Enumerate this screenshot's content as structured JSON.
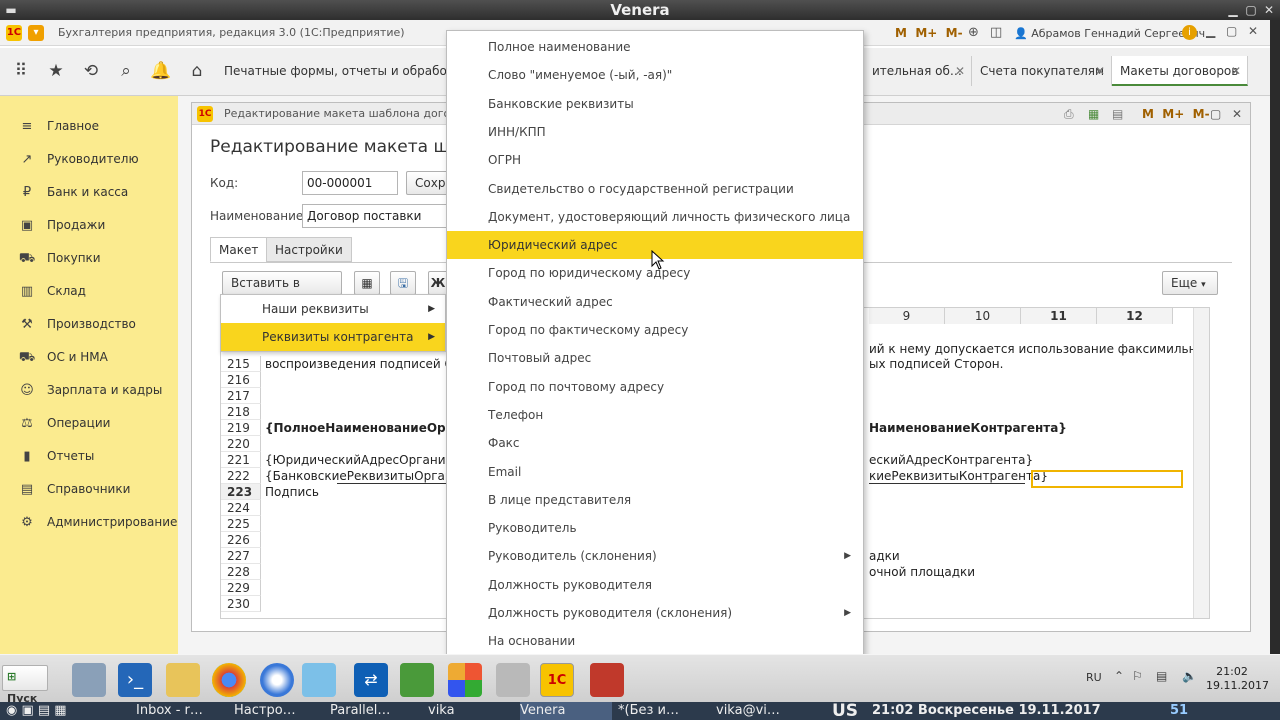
{
  "vnc": {
    "title": "Venera"
  },
  "app": {
    "title": "Бухгалтерия предприятия, редакция 3.0 (1С:Предприятие)",
    "user": "Абрамов Геннадий Сергеевич",
    "mplus_labels": [
      "M",
      "M+",
      "M-"
    ]
  },
  "nav": {
    "tabs": [
      {
        "label": "Печатные формы, отчеты и обработки"
      },
      {
        "label": "ительная об…"
      },
      {
        "label": "Счета покупателям"
      },
      {
        "label": "Макеты договоров"
      }
    ]
  },
  "sidebar": {
    "items": [
      {
        "label": "Главное",
        "icon": "menu-icon"
      },
      {
        "label": "Руководителю",
        "icon": "trend-icon"
      },
      {
        "label": "Банк и касса",
        "icon": "coin-icon"
      },
      {
        "label": "Продажи",
        "icon": "bag-icon"
      },
      {
        "label": "Покупки",
        "icon": "cart-icon"
      },
      {
        "label": "Склад",
        "icon": "warehouse-icon"
      },
      {
        "label": "Производство",
        "icon": "factory-icon"
      },
      {
        "label": "ОС и НМА",
        "icon": "truck-icon"
      },
      {
        "label": "Зарплата и кадры",
        "icon": "person-icon"
      },
      {
        "label": "Операции",
        "icon": "operations-icon"
      },
      {
        "label": "Отчеты",
        "icon": "reports-icon"
      },
      {
        "label": "Справочники",
        "icon": "book-icon"
      },
      {
        "label": "Администрирование",
        "icon": "gear-icon"
      }
    ]
  },
  "document": {
    "window_title": "Редактирование макета шаблона договора *",
    "heading": "Редактирование макета шабл",
    "code_label": "Код:",
    "code_value": "00-000001",
    "save_button": "Сохр",
    "name_label": "Наименование:",
    "name_value": "Договор поставки",
    "tabs": [
      "Макет",
      "Настройки"
    ],
    "insert_button": "Вставить в текст",
    "bold_button": "Ж",
    "more_button": "Еще",
    "submenu": [
      "Наши реквизиты",
      "Реквизиты контрагента"
    ],
    "col_headers": [
      "9",
      "10",
      "11",
      "12"
    ],
    "rows": [
      {
        "num": "215",
        "left": "воспроизведения подписей Сто",
        "right": "ых подписей Сторон."
      },
      {
        "num": "216",
        "left": "",
        "right": ""
      },
      {
        "num": "217",
        "left": "",
        "right": ""
      },
      {
        "num": "218",
        "left": "",
        "right": ""
      },
      {
        "num": "219",
        "left": "{ПолноеНаименованиеОрган",
        "right": "НаименованиеКонтрагента}"
      },
      {
        "num": "220",
        "left": "",
        "right": ""
      },
      {
        "num": "221",
        "left": "{ЮридическийАдресОрганизац",
        "right": "ескийАдресКонтрагента}"
      },
      {
        "num": "222",
        "left": "{БанковскиеРеквизитыОрганиза",
        "right": "киеРеквизитыКонтрагента}"
      },
      {
        "num": "223",
        "left": "Подпись",
        "right": ""
      },
      {
        "num": "224",
        "left": "",
        "right": ""
      },
      {
        "num": "225",
        "left": "",
        "right": ""
      },
      {
        "num": "226",
        "left": "",
        "right": ""
      },
      {
        "num": "227",
        "left": "",
        "right": "адки"
      },
      {
        "num": "228",
        "left": "",
        "right": "очной площадки"
      },
      {
        "num": "229",
        "left": "",
        "right": ""
      },
      {
        "num": "230",
        "left": "",
        "right": ""
      }
    ],
    "row214_right": "ий к нему допускается использование факсимильного"
  },
  "dropdown": {
    "items": [
      {
        "label": "Полное наименование"
      },
      {
        "label": "Слово \"именуемое (-ый, -ая)\""
      },
      {
        "label": "Банковские реквизиты"
      },
      {
        "label": "ИНН/КПП"
      },
      {
        "label": "ОГРН"
      },
      {
        "label": "Свидетельство о государственной регистрации"
      },
      {
        "label": "Документ, удостоверяющий личность физического лица"
      },
      {
        "label": "Юридический адрес",
        "highlighted": true
      },
      {
        "label": "Город по юридическому адресу"
      },
      {
        "label": "Фактический адрес"
      },
      {
        "label": "Город по фактическому адресу"
      },
      {
        "label": "Почтовый адрес"
      },
      {
        "label": "Город по почтовому адресу"
      },
      {
        "label": "Телефон"
      },
      {
        "label": "Факс"
      },
      {
        "label": "Email"
      },
      {
        "label": "В лице представителя"
      },
      {
        "label": "Руководитель"
      },
      {
        "label": "Руководитель (склонения)",
        "submenu": true
      },
      {
        "label": "Должность руководителя"
      },
      {
        "label": "Должность руководителя (склонения)",
        "submenu": true
      },
      {
        "label": "На основании"
      }
    ]
  },
  "taskbar": {
    "start_label": "Пуск",
    "lang": "RU",
    "time": "21:02",
    "date": "19.11.2017"
  },
  "linux_taskbar": {
    "items": [
      "Inbox - r…",
      "Настро…",
      "Parallel…",
      "vika",
      "Venera",
      "*(Без и…",
      "vika@vi…"
    ],
    "layout": "US",
    "clock": "21:02 Воскресенье 19.11.2017",
    "workspace": "51"
  },
  "colors": {
    "accent": "#f9d51d",
    "sidebar": "#fbeb8f"
  }
}
